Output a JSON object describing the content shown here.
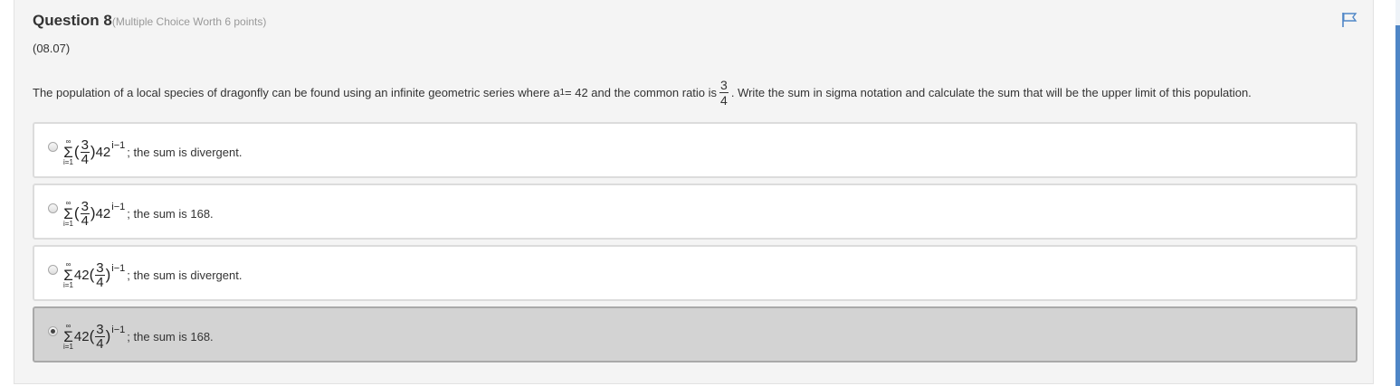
{
  "question": {
    "title": "Question 8",
    "meta": "(Multiple Choice Worth 6 points)",
    "code": "(08.07)",
    "text_before_sub": "The population of a local species of dragonfly can be found using an infinite geometric series where a",
    "sub": "1",
    "text_middle": " = 42 and the common ratio is",
    "ratio_num": "3",
    "ratio_den": "4",
    "text_after": ". Write the sum in sigma notation and calculate the sum that will be the upper limit of this population."
  },
  "options": [
    {
      "sigma_top": "∞",
      "sigma": "Σ",
      "sigma_bottom": "i=1",
      "open": "(",
      "frac_num": "3",
      "frac_den": "4",
      "close": ")",
      "base": "42",
      "exponent": "i−1",
      "tail": "; the sum is divergent.",
      "selected": false
    },
    {
      "sigma_top": "∞",
      "sigma": "Σ",
      "sigma_bottom": "i=1",
      "open": "(",
      "frac_num": "3",
      "frac_den": "4",
      "close": ")",
      "base": "42",
      "exponent": "i−1",
      "tail": "; the sum is 168.",
      "selected": false
    },
    {
      "sigma_top": "∞",
      "sigma": "Σ",
      "sigma_bottom": "i=1",
      "coef": "42",
      "open": "(",
      "frac_num": "3",
      "frac_den": "4",
      "close": ")",
      "exponent": "i−1",
      "tail": "; the sum is divergent.",
      "selected": false
    },
    {
      "sigma_top": "∞",
      "sigma": "Σ",
      "sigma_bottom": "i=1",
      "coef": "42",
      "open": "(",
      "frac_num": "3",
      "frac_den": "4",
      "close": ")",
      "exponent": "i−1",
      "tail": "; the sum is 168.",
      "selected": true
    }
  ],
  "icons": {
    "flag": "flag-icon"
  },
  "colors": {
    "accent": "#4f86c6",
    "selected_bg": "#d3d3d3",
    "panel_bg": "#f4f4f4"
  }
}
